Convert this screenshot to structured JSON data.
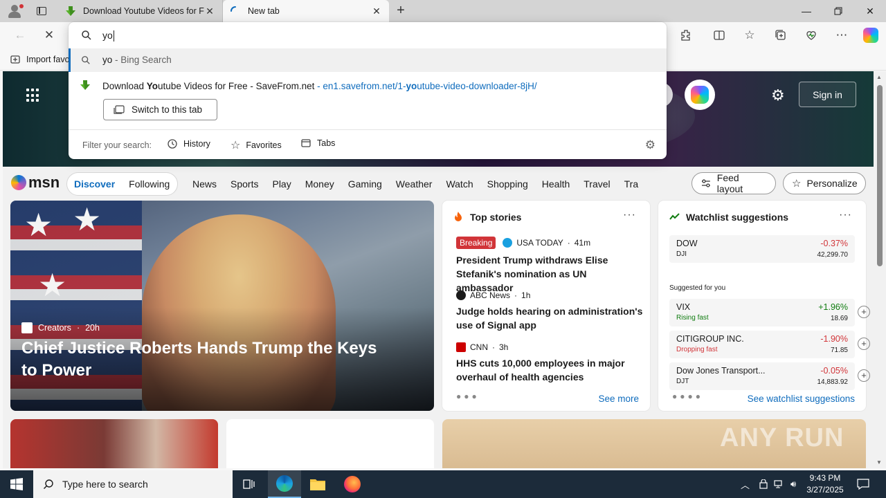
{
  "browser": {
    "tabs": [
      {
        "title": "Download Youtube Videos for Free",
        "active": false
      },
      {
        "title": "New tab",
        "active": true
      }
    ],
    "favorites_bar": {
      "import_label": "Import favo"
    }
  },
  "omnibox": {
    "query": "yo",
    "suggestions": [
      {
        "type": "search",
        "term": "yo",
        "suffix": " - Bing Search"
      },
      {
        "type": "open-tab",
        "title_pre": "Download ",
        "title_bold": "Yo",
        "title_post": "utube Videos for Free - SaveFrom.net",
        "url_pre": " - en1.savefrom.net/1-",
        "url_bold": "yo",
        "url_post": "utube-video-downloader-8jH/",
        "action": "Switch to this tab"
      }
    ],
    "filter": {
      "label": "Filter your search:",
      "chips": [
        "History",
        "Favorites",
        "Tabs"
      ]
    }
  },
  "msn": {
    "signin": "Sign in",
    "logo": "msn",
    "segment": [
      "Discover",
      "Following"
    ],
    "nav": [
      "News",
      "Sports",
      "Play",
      "Money",
      "Gaming",
      "Weather",
      "Watch",
      "Shopping",
      "Health",
      "Travel",
      "Tra"
    ],
    "feed_layout": "Feed layout",
    "personalize": "Personalize",
    "hero": {
      "source": "Creators",
      "age": "20h",
      "headline": "Chief Justice Roberts Hands Trump the Keys to Power"
    },
    "top_stories": {
      "title": "Top stories",
      "stories": [
        {
          "badge": "Breaking",
          "source": "USA TODAY",
          "age": "41m",
          "headline": "President Trump withdraws Elise Stefanik's nomination as UN ambassador"
        },
        {
          "source": "ABC News",
          "age": "1h",
          "headline": "Judge holds hearing on administration's use of Signal app"
        },
        {
          "source": "CNN",
          "age": "3h",
          "headline": "HHS cuts 10,000 employees in major overhaul of health agencies"
        }
      ],
      "see_more": "See more"
    },
    "watchlist": {
      "title": "Watchlist suggestions",
      "main": {
        "name": "DOW",
        "sub": "DJI",
        "pct": "-0.37%",
        "value": "42,299.70"
      },
      "suggested_label": "Suggested for you",
      "items": [
        {
          "name": "VIX",
          "sub": "Rising fast",
          "pct": "+1.96%",
          "value": "18.69",
          "trend": "up"
        },
        {
          "name": "CITIGROUP INC.",
          "sub": "Dropping fast",
          "pct": "-1.90%",
          "value": "71.85",
          "trend": "down"
        },
        {
          "name": "Dow Jones Transport...",
          "sub": "DJT",
          "pct": "-0.05%",
          "value": "14,883.92",
          "trend": "down"
        }
      ],
      "see_link": "See watchlist suggestions"
    }
  },
  "taskbar": {
    "search_placeholder": "Type here to search",
    "time": "9:43 PM",
    "date": "3/27/2025"
  },
  "watermark": "ANY RUN",
  "colors": {
    "accent": "#0f6cbd",
    "negative": "#d13438",
    "positive": "#107c10",
    "taskbar": "#1c2b3a"
  }
}
